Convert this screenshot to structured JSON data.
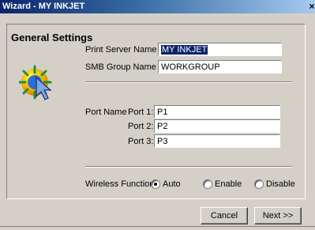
{
  "window": {
    "title": "Wizard - MY INKJET",
    "close_glyph": "×"
  },
  "section": {
    "title": "General Settings"
  },
  "print_server": {
    "label": "Print Server Name",
    "value": "MY INKJET"
  },
  "smb_group": {
    "label": "SMB Group Name",
    "value": "WORKGROUP"
  },
  "port_name": {
    "label": "Port Name",
    "ports": [
      {
        "label": "Port 1:",
        "value": "P1"
      },
      {
        "label": "Port 2:",
        "value": "P2"
      },
      {
        "label": "Port 3:",
        "value": "P3"
      }
    ]
  },
  "wireless": {
    "label": "Wireless Function",
    "options": [
      {
        "label": "Auto",
        "selected": true
      },
      {
        "label": "Enable",
        "selected": false
      },
      {
        "label": "Disable",
        "selected": false
      }
    ]
  },
  "buttons": {
    "cancel": "Cancel",
    "next": "Next >>"
  },
  "icons": {
    "wizard": "globe-cursor-icon"
  },
  "colors": {
    "titlebar_start": "#0a246a",
    "titlebar_end": "#a6caf0",
    "selection": "#0a246a",
    "face": "#d4d0c8"
  }
}
